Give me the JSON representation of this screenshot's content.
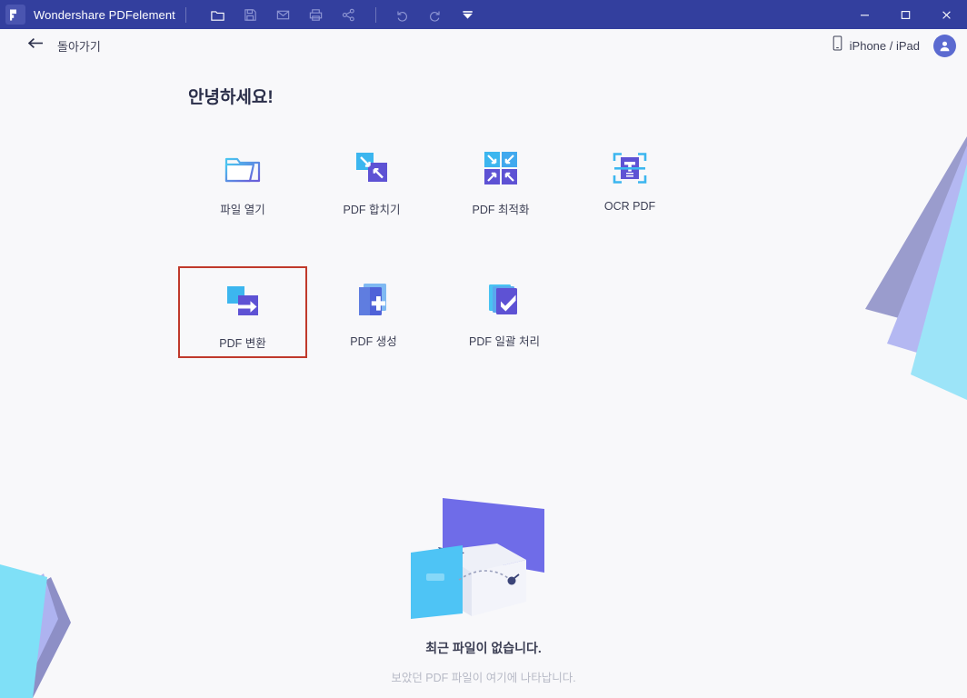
{
  "window": {
    "title": "Wondershare PDFelement",
    "logo_icon": "pdfelement-logo-icon",
    "toolbar": [
      {
        "name": "open-file-icon",
        "tip": "Open"
      },
      {
        "name": "save-icon",
        "tip": "Save"
      },
      {
        "name": "email-icon",
        "tip": "Email"
      },
      {
        "name": "print-icon",
        "tip": "Print"
      },
      {
        "name": "share-icon",
        "tip": "Share"
      },
      {
        "name": "undo-icon",
        "tip": "Undo"
      },
      {
        "name": "redo-icon",
        "tip": "Redo"
      },
      {
        "name": "dropdown-icon",
        "tip": "More"
      }
    ],
    "controls": {
      "minimize": "minimize-icon",
      "maximize": "maximize-icon",
      "close": "close-icon"
    }
  },
  "header": {
    "back_icon": "arrow-left-icon",
    "back_label": "돌아가기",
    "device_icon": "mobile-device-icon",
    "device_label": "iPhone / iPad",
    "avatar_icon": "user-avatar-icon"
  },
  "main": {
    "greeting": "안녕하세요!",
    "tiles": [
      {
        "id": "open-file",
        "label": "파일 열기",
        "icon": "folder-open-icon",
        "selected": false
      },
      {
        "id": "merge-pdf",
        "label": "PDF 합치기",
        "icon": "merge-pdf-icon",
        "selected": false
      },
      {
        "id": "optimize-pdf",
        "label": "PDF 최적화",
        "icon": "optimize-pdf-icon",
        "selected": false
      },
      {
        "id": "ocr-pdf",
        "label": "OCR PDF",
        "icon": "ocr-pdf-icon",
        "selected": false
      },
      {
        "id": "convert-pdf",
        "label": "PDF 변환",
        "icon": "convert-pdf-icon",
        "selected": true
      },
      {
        "id": "create-pdf",
        "label": "PDF 생성",
        "icon": "create-pdf-icon",
        "selected": false
      },
      {
        "id": "batch-pdf",
        "label": "PDF 일괄 처리",
        "icon": "batch-pdf-icon",
        "selected": false
      }
    ]
  },
  "empty_state": {
    "illustration": "empty-box-illustration",
    "title": "최근 파일이 없습니다.",
    "subtitle": "보았던 PDF 파일이 여기에 나타납니다."
  },
  "colors": {
    "titlebar": "#333f9e",
    "background": "#f8f8fa",
    "accent_blue": "#4a90f0",
    "accent_purple": "#5b57d8",
    "selection_red": "#c0392b",
    "text_primary": "#3c3f54",
    "text_muted": "#b7bac6"
  }
}
